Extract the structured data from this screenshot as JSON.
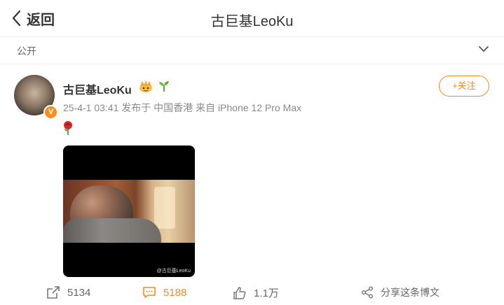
{
  "header": {
    "back_label": "返回",
    "title": "古巨基LeoKu"
  },
  "visibility": {
    "label": "公开"
  },
  "post": {
    "author": "古巨基LeoKu",
    "verified_badge": "V",
    "meta": "25-4-1 03:41 发布于 中国香港 来自 iPhone 12 Pro Max",
    "follow_label": "+关注",
    "content_emoji": "rose",
    "watermark": "@古巨基LeoKu"
  },
  "actions": {
    "share_count": "5134",
    "comment_count": "5188",
    "like_count": "1.1万",
    "share_weibo_label": "分享这条博文"
  },
  "colors": {
    "accent": "#f08a24",
    "badge": "#f5901e",
    "meta_text": "#8a8a8a"
  },
  "icons": [
    "back-chevron-icon",
    "chevron-down-icon",
    "crown-icon",
    "sprout-icon",
    "rose-icon",
    "repost-icon",
    "comment-icon",
    "like-icon",
    "share-icon"
  ]
}
